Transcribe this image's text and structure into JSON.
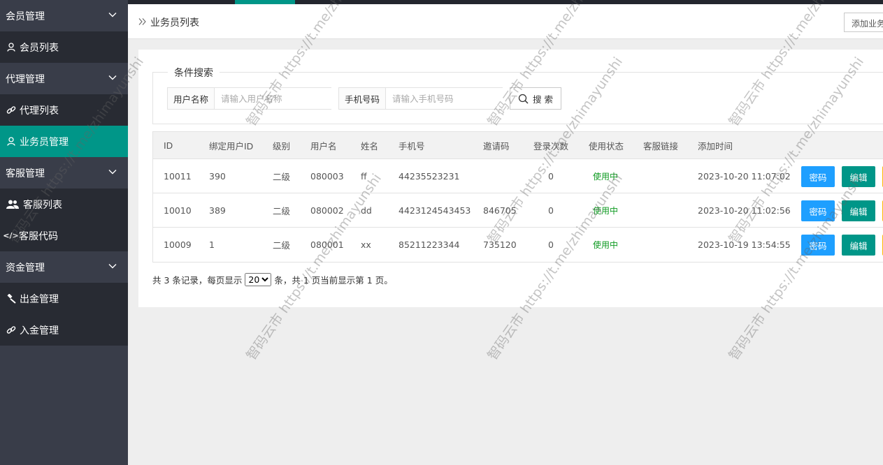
{
  "sidebar": {
    "groups": [
      {
        "label": "会员管理",
        "items": [
          {
            "label": "会员列表",
            "icon": "user-icon"
          }
        ]
      },
      {
        "label": "代理管理",
        "items": [
          {
            "label": "代理列表",
            "icon": "link-icon"
          },
          {
            "label": "业务员管理",
            "icon": "user-icon",
            "active": true
          }
        ]
      },
      {
        "label": "客服管理",
        "items": [
          {
            "label": "客服列表",
            "icon": "users-icon"
          },
          {
            "label": "客服代码",
            "icon": "code-icon"
          }
        ]
      },
      {
        "label": "资金管理",
        "items": [
          {
            "label": "出金管理",
            "icon": "gavel-icon"
          },
          {
            "label": "入金管理",
            "icon": "link-icon"
          }
        ]
      }
    ]
  },
  "header": {
    "breadcrumb": "业务员列表",
    "add_button": "添加业务员"
  },
  "search": {
    "legend": "条件搜索",
    "username_label": "用户名称",
    "username_placeholder": "请输入用户名称",
    "phone_label": "手机号码",
    "phone_placeholder": "请输入手机号码",
    "button": "搜 索"
  },
  "table": {
    "columns": [
      "ID",
      "绑定用户ID",
      "级别",
      "用户名",
      "姓名",
      "手机号",
      "邀请码",
      "登录次数",
      "使用状态",
      "客服链接",
      "添加时间"
    ],
    "rows": [
      [
        "10011",
        "390",
        "二级",
        "080003",
        "ff",
        "44235523231",
        "",
        "0",
        "使用中",
        "",
        "2023-10-20 11:07:02"
      ],
      [
        "10010",
        "389",
        "二级",
        "080002",
        "dd",
        "4423124543453",
        "846705",
        "0",
        "使用中",
        "",
        "2023-10-20 11:02:56"
      ],
      [
        "10009",
        "1",
        "二级",
        "080001",
        "xx",
        "85211223344",
        "735120",
        "0",
        "使用中",
        "",
        "2023-10-19 13:54:55"
      ]
    ],
    "actions": {
      "password": "密码",
      "edit": "编辑"
    }
  },
  "pager": {
    "prefix": "共 3 条记录，每页显示",
    "page_size": "20",
    "suffix": "条，共 1 页当前显示第 1 页。"
  },
  "watermark": "智码云市 https://t.me/zhimayunshi",
  "colors": {
    "sidebar_bg": "#393d49",
    "sidebar_sub_bg": "#282b33",
    "accent": "#009688",
    "primary_blue": "#1e9fff",
    "status_green": "#0d9a20",
    "warn_yellow": "#ffb800"
  }
}
